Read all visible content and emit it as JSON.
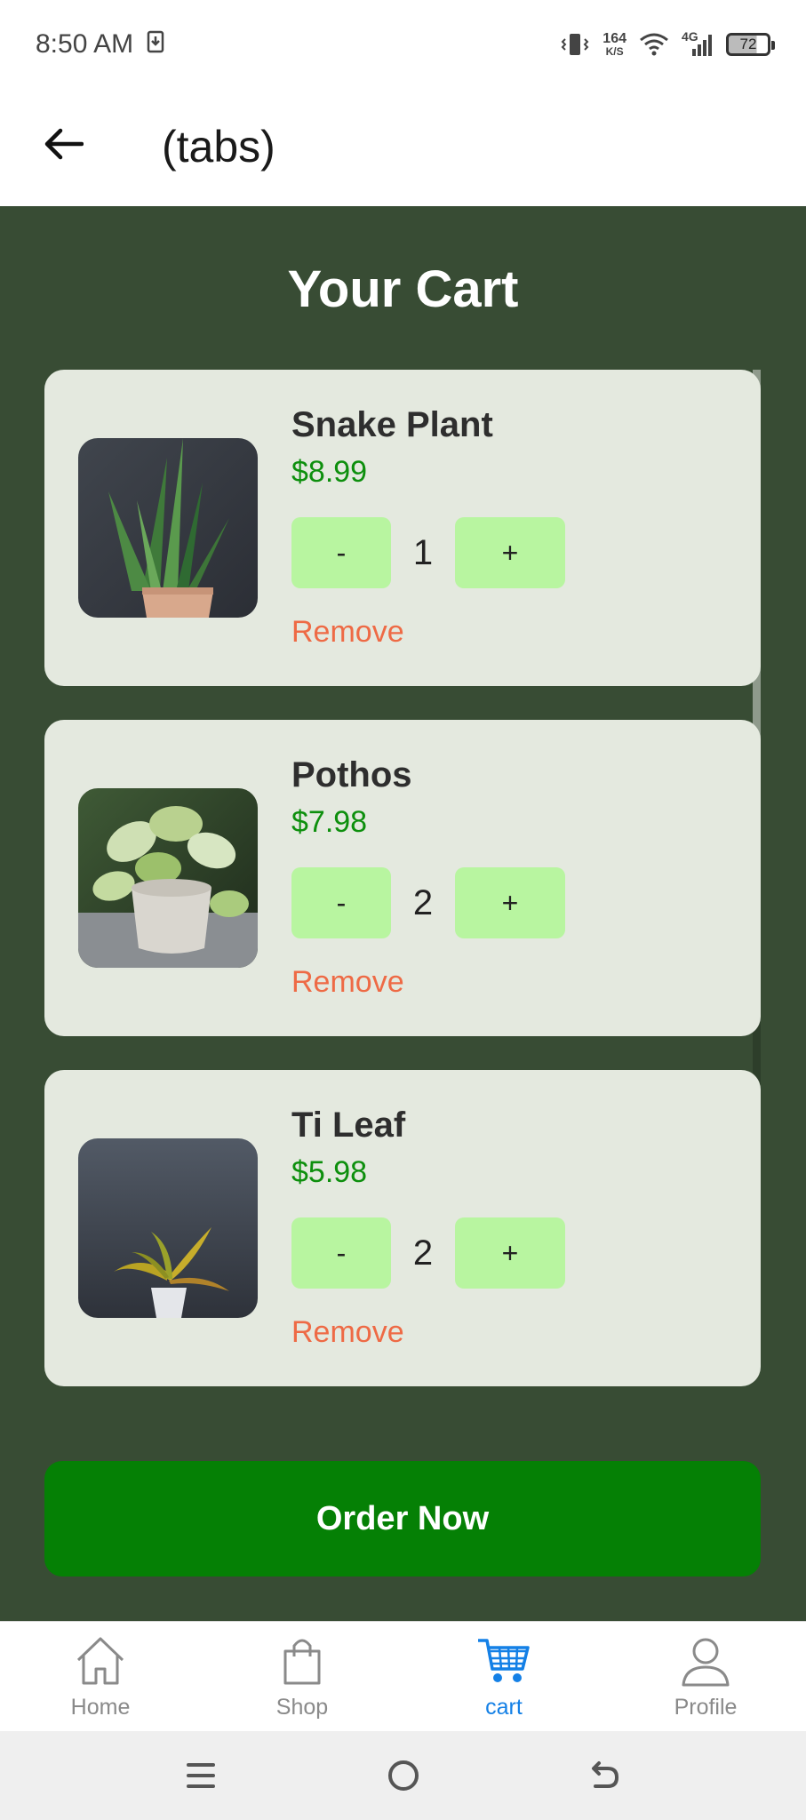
{
  "status_bar": {
    "time": "8:50 AM",
    "net_speed_value": "164",
    "net_speed_unit": "K/S",
    "network": "4G",
    "battery": "72",
    "icons": [
      "download-icon",
      "vibrate-icon",
      "wifi-icon",
      "signal-icon",
      "battery-icon"
    ]
  },
  "header": {
    "title": "(tabs)",
    "back_icon": "arrow-left-icon"
  },
  "cart": {
    "title": "Your Cart",
    "items": [
      {
        "name": "Snake Plant",
        "price": "$8.99",
        "quantity": "1",
        "minus_label": "-",
        "plus_label": "+",
        "remove_label": "Remove",
        "image": "snake-plant-image"
      },
      {
        "name": "Pothos",
        "price": "$7.98",
        "quantity": "2",
        "minus_label": "-",
        "plus_label": "+",
        "remove_label": "Remove",
        "image": "pothos-image"
      },
      {
        "name": "Ti Leaf",
        "price": "$5.98",
        "quantity": "2",
        "minus_label": "-",
        "plus_label": "+",
        "remove_label": "Remove",
        "image": "ti-leaf-image"
      }
    ],
    "order_label": "Order Now"
  },
  "tabs": [
    {
      "label": "Home",
      "icon": "home-icon",
      "active": false
    },
    {
      "label": "Shop",
      "icon": "shopping-bag-icon",
      "active": false
    },
    {
      "label": "cart",
      "icon": "cart-icon",
      "active": true
    },
    {
      "label": "Profile",
      "icon": "profile-icon",
      "active": false
    }
  ],
  "colors": {
    "background": "#384c34",
    "card": "#e4e9df",
    "price": "#0d8f0d",
    "qty_button": "#b8f5a0",
    "remove": "#ee6a45",
    "order_button": "#058005",
    "active_tab": "#1480e6"
  },
  "system_nav": [
    "menu-icon",
    "home-circle-icon",
    "back-icon"
  ]
}
